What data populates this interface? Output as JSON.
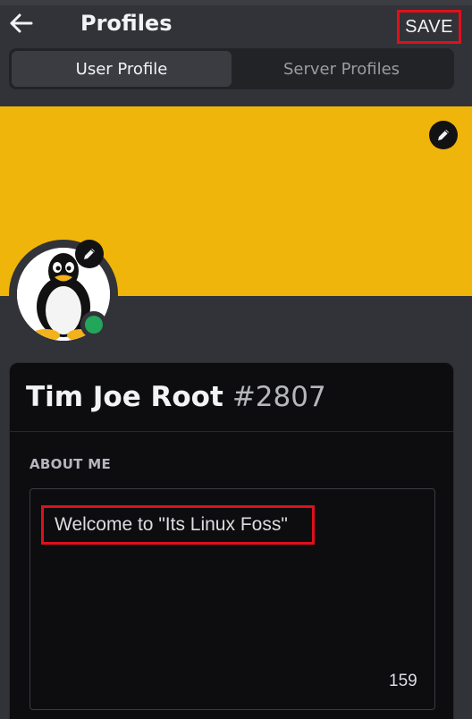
{
  "header": {
    "back_icon": "arrow-left-icon",
    "title": "Profiles",
    "save_label": "SAVE"
  },
  "tabs": [
    {
      "label": "User Profile",
      "active": true
    },
    {
      "label": "Server Profiles",
      "active": false
    }
  ],
  "banner": {
    "color": "#f0b50a",
    "edit_icon": "pencil-icon"
  },
  "avatar": {
    "image": "tux-penguin",
    "status": "online",
    "status_color": "#23a55a",
    "edit_icon": "pencil-icon"
  },
  "profile": {
    "display_name": "Tim Joe Root",
    "discriminator": "#2807",
    "about_me_label": "ABOUT ME",
    "about_me_text": "Welcome to \"Its Linux Foss\"",
    "char_count": "159"
  },
  "colors": {
    "background": "#313338",
    "card": "#0d0d0f",
    "highlight": "#e0101a"
  }
}
